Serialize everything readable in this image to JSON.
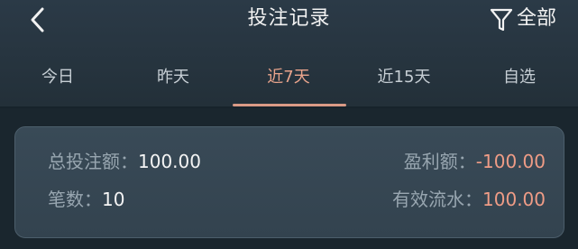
{
  "header": {
    "title": "投注记录",
    "filter_label": "全部"
  },
  "tabs": [
    {
      "label": "今日",
      "active": false
    },
    {
      "label": "昨天",
      "active": false
    },
    {
      "label": "近7天",
      "active": true
    },
    {
      "label": "近15天",
      "active": false
    },
    {
      "label": "自选",
      "active": false
    }
  ],
  "summary": {
    "total_bet_label": "总投注额：",
    "total_bet_value": "100.00",
    "count_label": "笔数：",
    "count_value": "10",
    "profit_label": "盈利额：",
    "profit_value": "-100.00",
    "valid_flow_label": "有效流水：",
    "valid_flow_value": "100.00"
  },
  "colors": {
    "accent": "#e9a48c",
    "negative": "#ef9c86",
    "background": "#1f2a33"
  },
  "icons": {
    "back": "chevron-left-icon",
    "filter": "funnel-icon"
  }
}
